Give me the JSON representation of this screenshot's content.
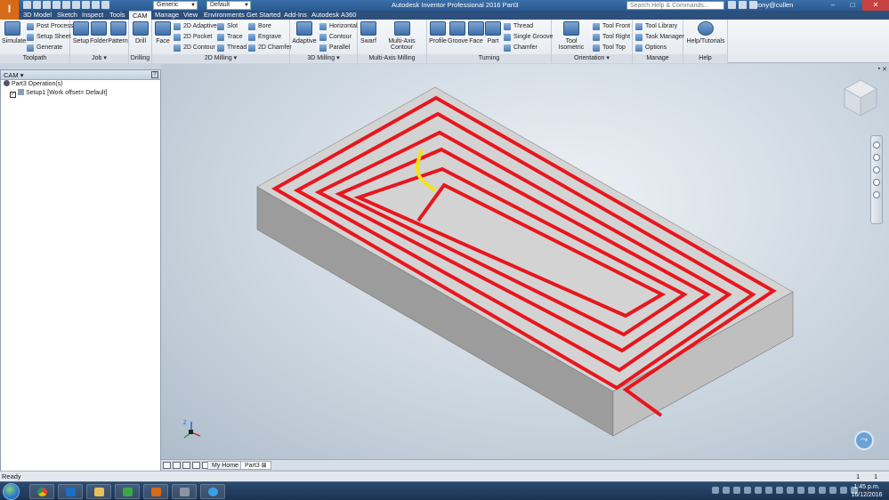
{
  "titlebar": {
    "app_logo": "I",
    "appearance_combo": "Generic",
    "style_combo": "Default",
    "window_title": "Autodesk Inventor Professional 2016    Part3",
    "search_placeholder": "Search Help & Commands...",
    "user": "tony@cullen"
  },
  "tabs": [
    "3D Model",
    "Sketch",
    "Inspect",
    "Tools",
    "CAM",
    "Manage",
    "View",
    "Environments",
    "Get Started",
    "Add-Ins",
    "Autodesk A360"
  ],
  "ribbon": {
    "toolpath": {
      "label": "Toolpath",
      "simulate": "Simulate",
      "post_process": "Post Process",
      "setup_sheet": "Setup Sheet",
      "generate": "Generate"
    },
    "job": {
      "label": "Job ▾",
      "setup": "Setup",
      "folder": "Folder",
      "pattern": "Pattern"
    },
    "drilling": {
      "label": "Drilling",
      "drill": "Drill"
    },
    "milling2d": {
      "label": "2D Milling ▾",
      "face": "Face",
      "adaptive2d": "2D Adaptive",
      "pocket2d": "2D Pocket",
      "contour2d": "2D Contour",
      "slot": "Slot",
      "trace": "Trace",
      "thread": "Thread",
      "bore": "Bore",
      "engrave": "Engrave",
      "chamfer2d": "2D Chamfer"
    },
    "milling3d": {
      "label": "3D Milling ▾",
      "adaptive": "Adaptive",
      "horizontal": "Horizontal",
      "contour": "Contour",
      "parallel": "Parallel"
    },
    "multiaxis": {
      "label": "Multi-Axis Milling",
      "swarf": "Swarf",
      "multi_axis_contour": "Multi-Axis Contour"
    },
    "turning": {
      "label": "Turning",
      "profile": "Profile",
      "groove": "Groove",
      "face": "Face",
      "part": "Part",
      "thread": "Thread",
      "single_groove": "Single Groove",
      "chamfer": "Chamfer"
    },
    "orientation": {
      "label": "Orientation ▾",
      "tool_isometric": "Tool Isometric",
      "tool_front": "Tool Front",
      "tool_right": "Tool Right",
      "tool_top": "Tool Top"
    },
    "manage": {
      "label": "Manage",
      "tool_library": "Tool Library",
      "task_manager": "Task Manager",
      "options": "Options"
    },
    "help": {
      "label": "Help",
      "help_tutorials": "Help/Tutorials"
    }
  },
  "browser": {
    "title": "CAM ▾",
    "help": "?",
    "root": "Part3 Operation(s)",
    "setup": "Setup1 [Work offset= Default]"
  },
  "viewport": {
    "toolpath_color": "#e8161d",
    "entry_color": "#f2e419",
    "stock_top_color": "#d3d3d3"
  },
  "doctabs": {
    "home": "My Home",
    "part": "Part3",
    "close": "⊠"
  },
  "status": {
    "text": "Ready",
    "count_a": "1",
    "count_b": "1"
  },
  "clock": {
    "time": "1:45 p.m.",
    "date": "16/12/2016"
  }
}
